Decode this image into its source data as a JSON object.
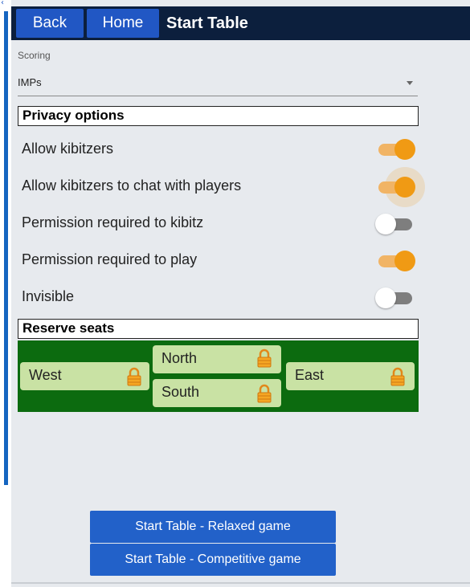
{
  "header": {
    "back_label": "Back",
    "home_label": "Home",
    "title": "Start Table"
  },
  "scoring": {
    "label": "Scoring",
    "value": "IMPs"
  },
  "privacy": {
    "title": "Privacy options",
    "options": [
      {
        "label": "Allow kibitzers",
        "on": true
      },
      {
        "label": "Allow kibitzers to chat with players",
        "on": true
      },
      {
        "label": "Permission required to kibitz",
        "on": false
      },
      {
        "label": "Permission required to play",
        "on": true
      },
      {
        "label": "Invisible",
        "on": false
      }
    ]
  },
  "reserve": {
    "title": "Reserve seats",
    "seats": {
      "west": "West",
      "north": "North",
      "south": "South",
      "east": "East"
    }
  },
  "actions": {
    "relaxed_label": "Start Table - Relaxed game",
    "competitive_label": "Start Table - Competitive game"
  },
  "colors": {
    "header_bg": "#0c1f3d",
    "button_blue": "#2157c4",
    "toggle_on": "#f09a14",
    "seat_panel_green": "#0c6b0f",
    "seat_bg": "#c9e2a4"
  },
  "icons": {
    "lock": "padlock-icon",
    "select_caret": "caret-down-icon"
  }
}
